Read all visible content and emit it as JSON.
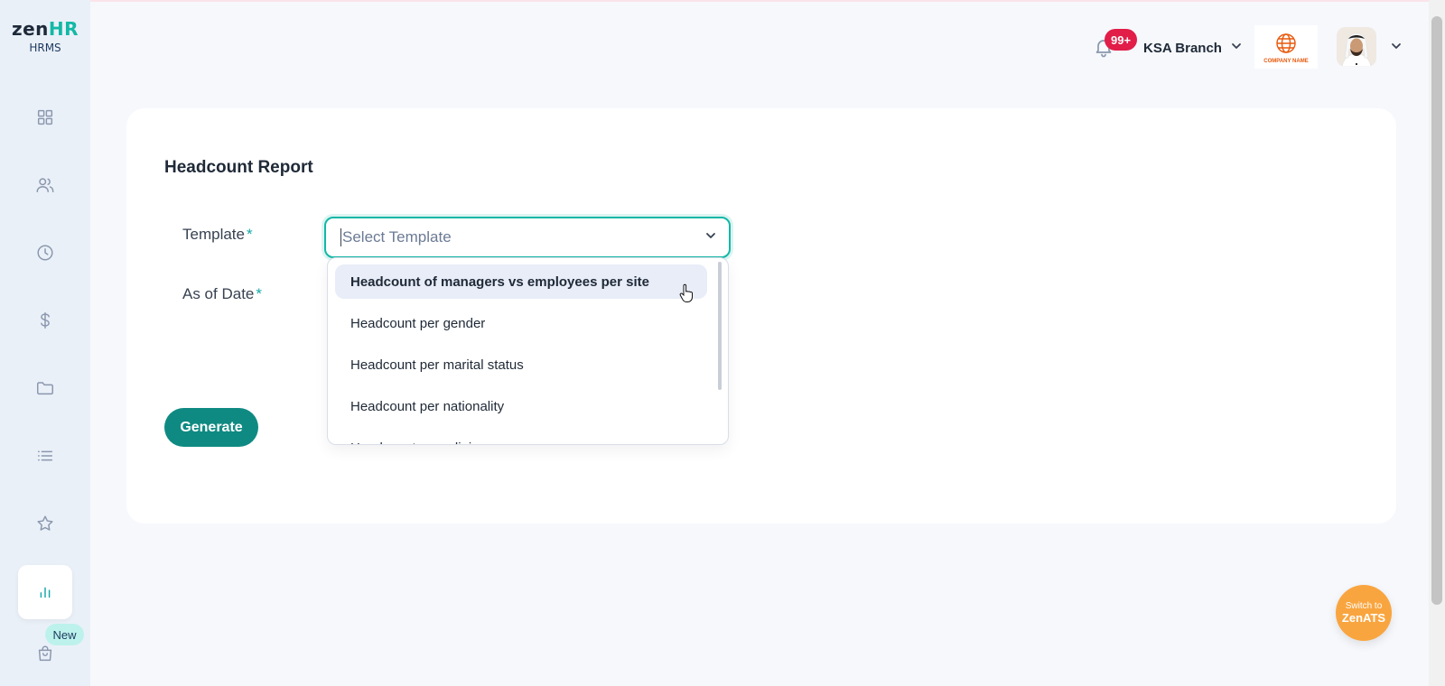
{
  "brand": {
    "logo_prefix": "zen",
    "logo_suffix": "HR",
    "subtitle": "HRMS"
  },
  "sidebar": {
    "items": [
      {
        "icon": "dashboard-icon"
      },
      {
        "icon": "users-icon"
      },
      {
        "icon": "clock-icon"
      },
      {
        "icon": "dollar-icon"
      },
      {
        "icon": "folder-icon"
      },
      {
        "icon": "list-icon"
      },
      {
        "icon": "star-icon"
      },
      {
        "icon": "bar-chart-icon",
        "active": true
      },
      {
        "icon": "shopping-bag-icon"
      }
    ],
    "new_badge": "New"
  },
  "header": {
    "notification_count": "99+",
    "branch_label": "KSA Branch",
    "company_logo_text": "COMPANY NAME"
  },
  "report": {
    "title": "Headcount Report",
    "template_label": "Template",
    "as_of_date_label": "As of Date",
    "required_marker": "*",
    "template_placeholder": "Select Template",
    "generate_label": "Generate"
  },
  "dropdown": {
    "options": [
      "Headcount of managers vs employees per site",
      "Headcount per gender",
      "Headcount per marital status",
      "Headcount per nationality",
      "Headcount per religion"
    ],
    "hovered_index": 0
  },
  "switch_button": {
    "line1": "Switch to",
    "line2": "ZenATS"
  },
  "colors": {
    "accent": "#14b8a6",
    "primary_button": "#0f8a82",
    "notification": "#e11d48",
    "switch": "#f9a53f"
  }
}
